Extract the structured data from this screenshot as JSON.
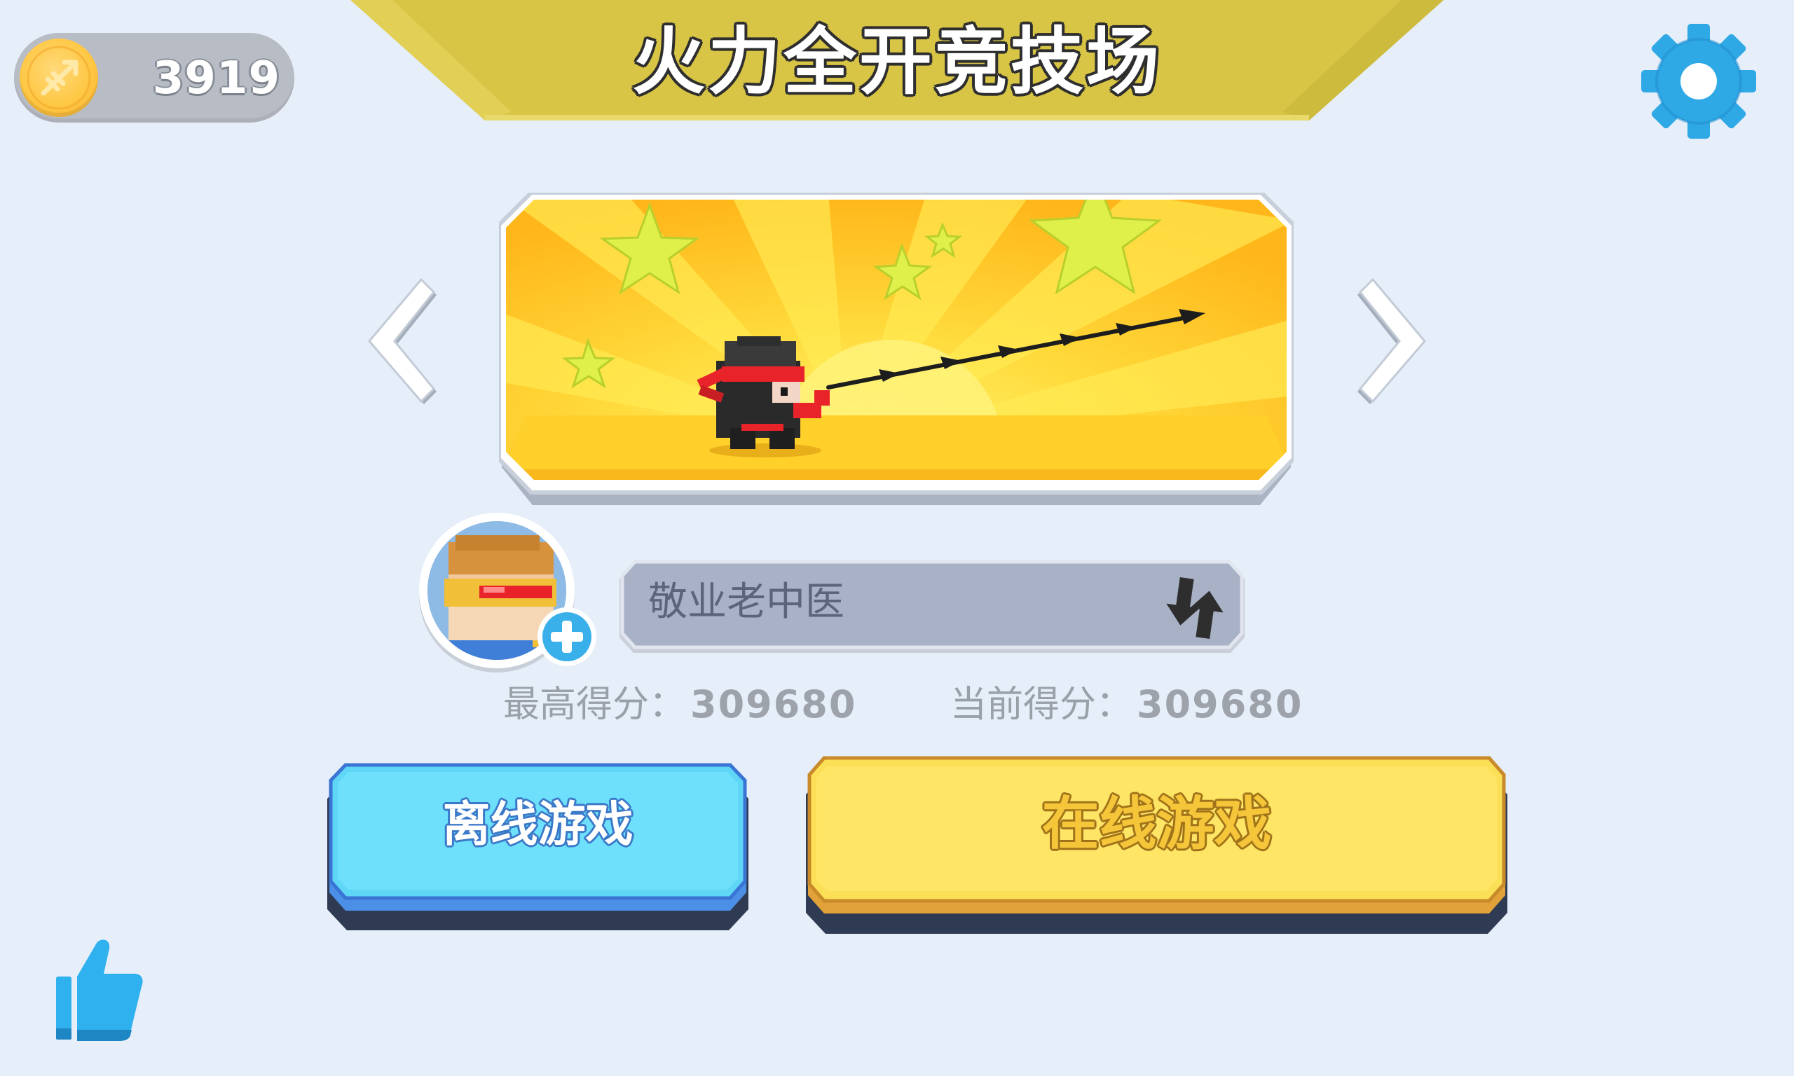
{
  "header": {
    "coins": "3919",
    "title": "火力全开竞技场",
    "coin_icon": "coin-icon",
    "settings_icon": "gear-icon"
  },
  "mode_carousel": {
    "prev_icon": "chevron-left-icon",
    "next_icon": "chevron-right-icon",
    "card_art": "ninja-throwing-spear-with-stars"
  },
  "player": {
    "avatar_icon": "pixel-hero-avatar",
    "add_icon": "plus-icon",
    "name": "敬业老中医",
    "refresh_icon": "refresh-arrows-icon"
  },
  "scores": {
    "best_label": "最高得分：",
    "best_value": "309680",
    "current_label": "当前得分：",
    "current_value": "309680"
  },
  "buttons": {
    "offline": "离线游戏",
    "online": "在线游戏"
  },
  "footer": {
    "like_icon": "thumbs-up-icon"
  },
  "colors": {
    "background": "#e6eef9",
    "banner": "#d8c546",
    "offline_button": "#5fd6f6",
    "online_button": "#fbdf57",
    "settings": "#2fa8e6"
  }
}
